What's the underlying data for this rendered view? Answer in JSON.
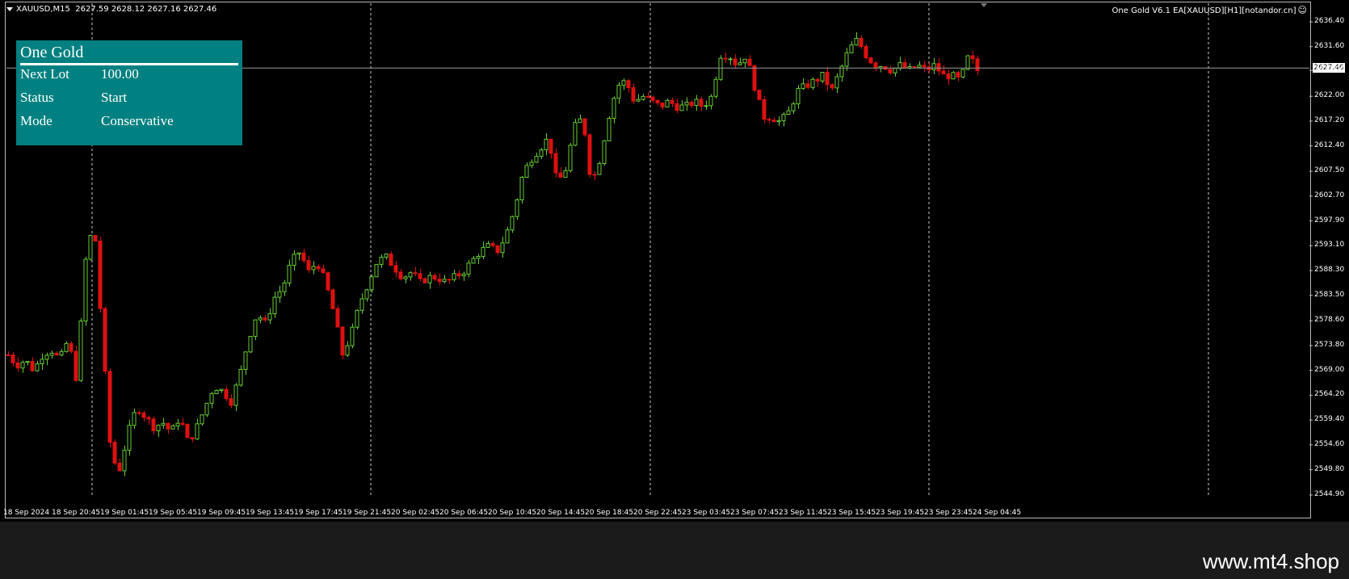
{
  "window": {
    "symbol_timeframe": "XAUUSD,M15",
    "ohlc": "2627.59 2628.12 2627.16 2627.46",
    "ea_label": "One Gold V6.1 EA[XAUUSD][H1][notandor.cn]",
    "ea_smile_icon": "smiley-icon"
  },
  "info_panel": {
    "title": "One Gold",
    "rows": [
      {
        "label": "Next Lot",
        "value": "100.00"
      },
      {
        "label": "Status",
        "value": "Start"
      },
      {
        "label": "Mode",
        "value": "Conservative"
      }
    ]
  },
  "price_axis": {
    "ticks": [
      "2636.40",
      "2631.60",
      "2627.00",
      "2622.00",
      "2617.20",
      "2612.40",
      "2607.50",
      "2602.70",
      "2597.90",
      "2593.10",
      "2588.30",
      "2583.50",
      "2578.60",
      "2573.80",
      "2569.00",
      "2564.20",
      "2559.40",
      "2554.60",
      "2549.80",
      "2544.90"
    ],
    "current_price": "2627.46"
  },
  "time_axis": {
    "ticks": [
      "18 Sep 2024",
      "18 Sep 20:45",
      "19 Sep 01:45",
      "19 Sep 05:45",
      "19 Sep 09:45",
      "19 Sep 13:45",
      "19 Sep 17:45",
      "19 Sep 21:45",
      "20 Sep 02:45",
      "20 Sep 06:45",
      "20 Sep 10:45",
      "20 Sep 14:45",
      "20 Sep 18:45",
      "20 Sep 22:45",
      "23 Sep 03:45",
      "23 Sep 07:45",
      "23 Sep 11:45",
      "23 Sep 15:45",
      "23 Sep 19:45",
      "23 Sep 23:45",
      "24 Sep 04:45"
    ]
  },
  "colors": {
    "background": "#000000",
    "bull": "#66cc33",
    "bear": "#dd1111",
    "panel": "#008080",
    "grid": "#cccccc"
  },
  "chart_data": {
    "type": "candlestick",
    "symbol": "XAUUSD",
    "timeframe": "M15",
    "ylim": [
      2544.9,
      2636.4
    ],
    "path": [
      2572,
      2570,
      2571,
      2569,
      2572,
      2573,
      2571,
      2575,
      2567,
      2590,
      2598,
      2575,
      2552,
      2550,
      2557,
      2562,
      2560,
      2558,
      2559,
      2557,
      2560,
      2555,
      2558,
      2562,
      2566,
      2565,
      2563,
      2568,
      2575,
      2580,
      2578,
      2583,
      2585,
      2590,
      2592,
      2588,
      2590,
      2586,
      2580,
      2572,
      2576,
      2582,
      2586,
      2590,
      2591,
      2589,
      2587,
      2588,
      2586,
      2587,
      2587,
      2586,
      2587,
      2588,
      2590,
      2592,
      2593,
      2592,
      2595,
      2600,
      2607,
      2610,
      2612,
      2614,
      2605,
      2608,
      2616,
      2618,
      2605,
      2610,
      2618,
      2624,
      2625,
      2621,
      2622,
      2621,
      2620,
      2621,
      2620,
      2620,
      2621,
      2620,
      2622,
      2630,
      2630,
      2628,
      2630,
      2624,
      2618,
      2618,
      2617,
      2619,
      2623,
      2624,
      2625,
      2626,
      2623,
      2627,
      2631,
      2633,
      2630,
      2628,
      2628,
      2627,
      2628,
      2627,
      2628,
      2627,
      2628,
      2626,
      2626,
      2625,
      2630,
      2627
    ]
  }
}
